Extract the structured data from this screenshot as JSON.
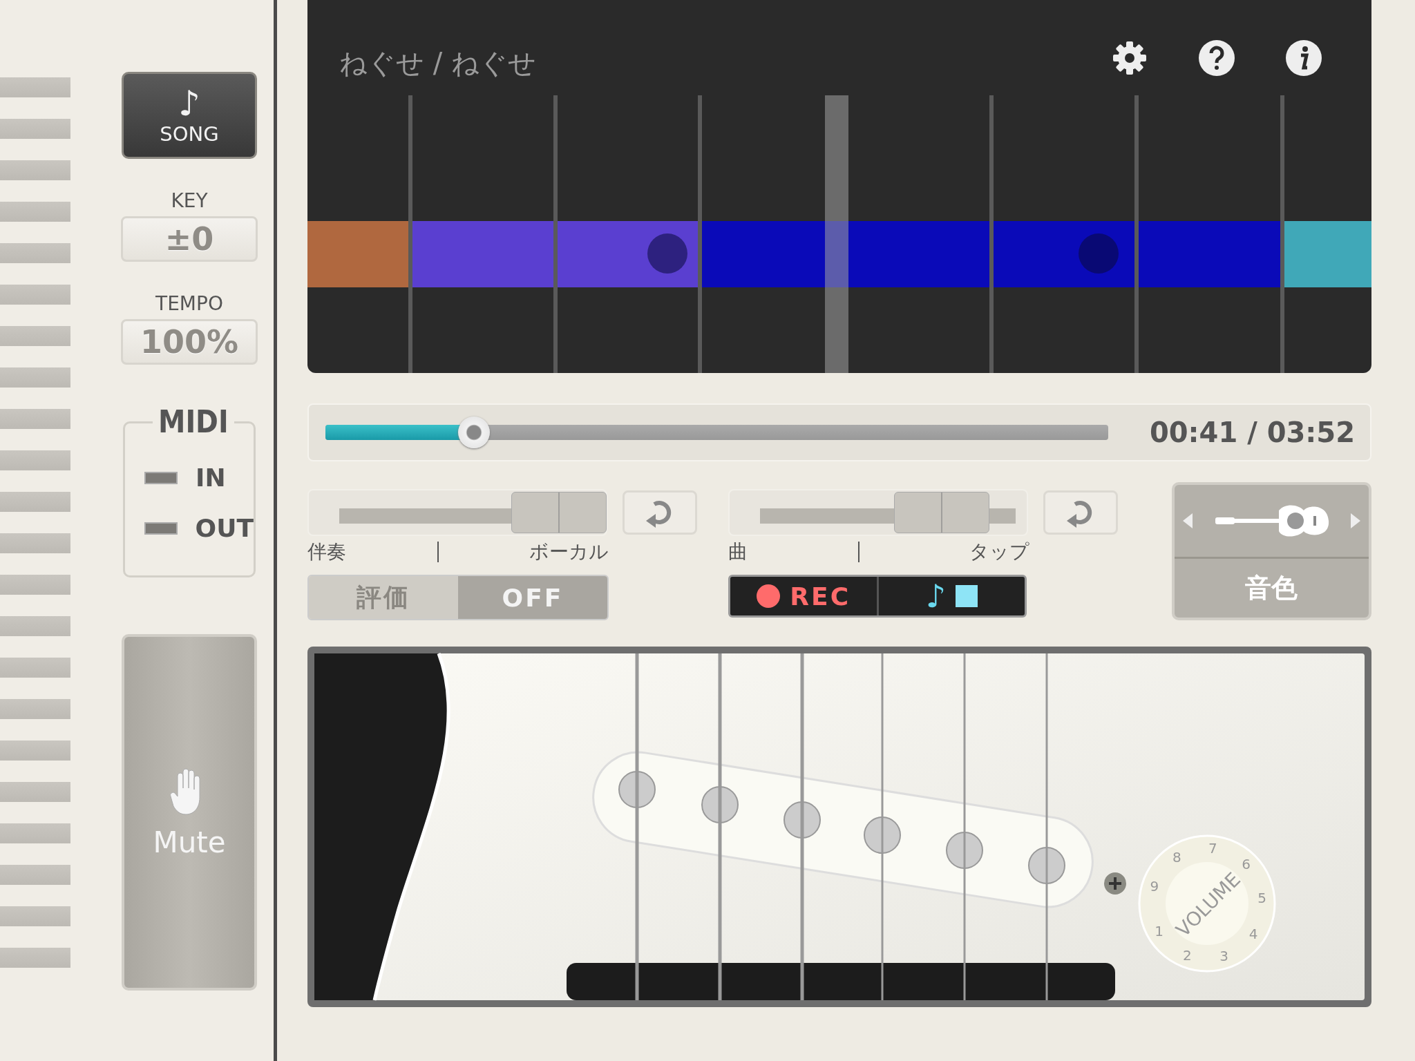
{
  "sidebar": {
    "song_button": {
      "icon": "♪",
      "label": "SONG"
    },
    "key": {
      "label": "KEY",
      "value": "±0"
    },
    "tempo": {
      "label": "TEMPO",
      "value": "100%"
    },
    "midi": {
      "title": "MIDI",
      "ports": [
        {
          "label": "IN",
          "on": false
        },
        {
          "label": "OUT",
          "on": false
        }
      ]
    },
    "mute_button": {
      "label": "Mute"
    }
  },
  "display": {
    "title": "ねぐせ / ねぐせ",
    "segments": [
      {
        "color": "#b0683f"
      },
      {
        "color": "#5a3fd0"
      },
      {
        "color": "#0a0ab8"
      },
      {
        "color": "#40a8b8"
      }
    ]
  },
  "progress": {
    "level": 0.19,
    "time": "00:41 / 03:52"
  },
  "mix_sliders": [
    {
      "level": 0.84,
      "left_label": "伴奏",
      "right_label": "ボーカル"
    },
    {
      "level": 0.71,
      "left_label": "曲",
      "right_label": "タップ"
    }
  ],
  "evaluation_switch": [
    {
      "label": "評価",
      "selected": false
    },
    {
      "label": "OFF",
      "selected": true
    }
  ],
  "recorder": {
    "rec_label": "REC",
    "play_icon": "♪"
  },
  "tone": {
    "label": "音色"
  },
  "volume_knob": {
    "label": "VOLUME",
    "numbers": [
      "1",
      "2",
      "3",
      "4",
      "5",
      "6",
      "7",
      "8",
      "9"
    ]
  }
}
